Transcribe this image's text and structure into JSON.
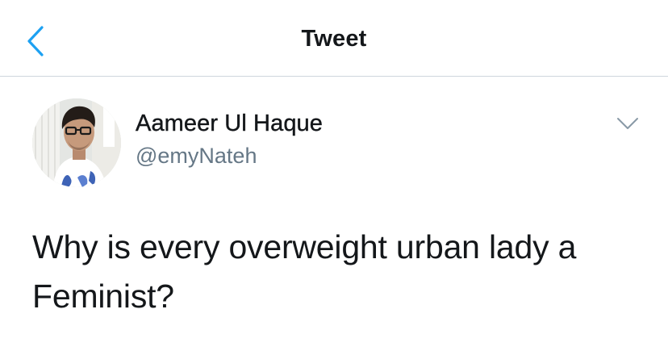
{
  "navbar": {
    "title": "Tweet",
    "back_icon": "chevron-left-icon",
    "accent_color": "#1da1f2"
  },
  "tweet": {
    "author_name": "Aameer Ul Haque",
    "author_handle": "@emyNateh",
    "more_icon": "chevron-down-icon",
    "text": "Why is every overweight urban lady a Feminist?"
  },
  "colors": {
    "text_primary": "#14171a",
    "text_secondary": "#657786",
    "divider": "#cfd6dc"
  }
}
